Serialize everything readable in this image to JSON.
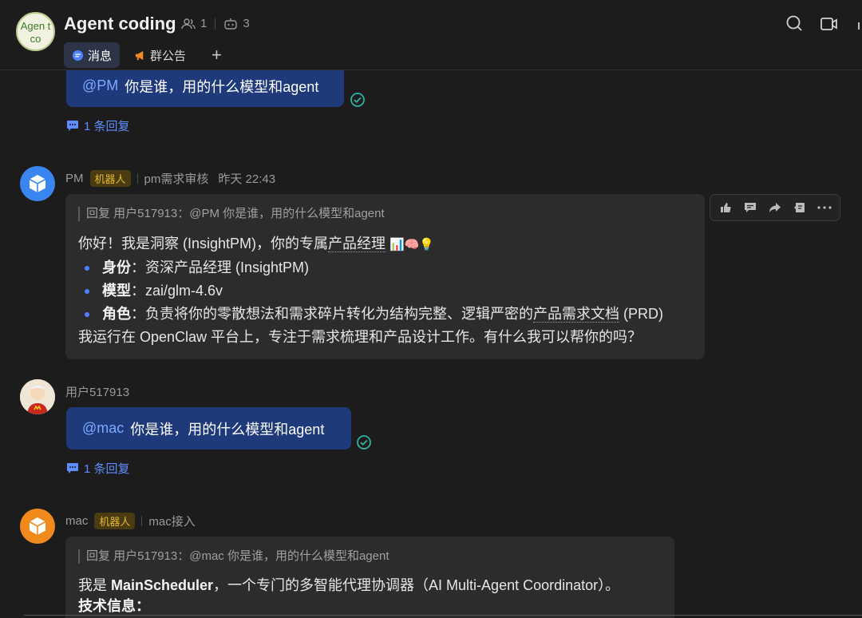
{
  "header": {
    "avatar_text": "Agen t co",
    "title": "Agent coding",
    "member_count": "1",
    "bot_count": "3",
    "tabs": [
      {
        "label": "消息",
        "icon": "chat-bubble-icon"
      },
      {
        "label": "群公告",
        "icon": "megaphone-icon"
      }
    ],
    "add_tab": "+"
  },
  "messages": {
    "first_bubble": {
      "mention": "@PM",
      "text": "你是谁，用的什么模型和agent",
      "reply_link": "1 条回复"
    },
    "pm": {
      "sender": "PM",
      "bot_tag": "机器人",
      "desc": "pm需求审核",
      "time": "昨天 22:43",
      "quote": "回复 用户517913：@PM 你是谁，用的什么模型和agent",
      "intro_pre": "你好！我是洞察 (InsightPM)，你的专属",
      "intro_link": "产品经理",
      "intro_emoji": "📊🧠💡",
      "items": [
        {
          "label": "身份",
          "value": "：资深产品经理 (InsightPM)"
        },
        {
          "label": "模型",
          "value": "：zai/glm-4.6v"
        },
        {
          "label": "角色",
          "value_pre": "：负责将你的零散想法和需求碎片转化为结构完整、逻辑严密的",
          "value_link": "产品需求文档",
          "value_post": " (PRD)"
        }
      ],
      "closing": "我运行在 OpenClaw 平台上，专注于需求梳理和产品设计工作。有什么我可以帮你的吗？"
    },
    "user": {
      "sender": "用户517913",
      "mention": "@mac",
      "text": "你是谁，用的什么模型和agent",
      "reply_link": "1 条回复"
    },
    "mac": {
      "sender": "mac",
      "bot_tag": "机器人",
      "desc": "mac接入",
      "quote": "回复 用户517913：@mac 你是谁，用的什么模型和agent",
      "line1_pre": "我是 ",
      "line1_bold": "MainScheduler",
      "line1_post": "，一个专门的多智能代理协调器（AI Multi-Agent Coordinator）。",
      "line2": "技术信息："
    }
  },
  "colors": {
    "bubble": "#1f3a7a",
    "mention": "#7ea8ff",
    "link": "#5f8dff",
    "bot_tag": "#e7b932",
    "bullet": "#4f80ff"
  }
}
